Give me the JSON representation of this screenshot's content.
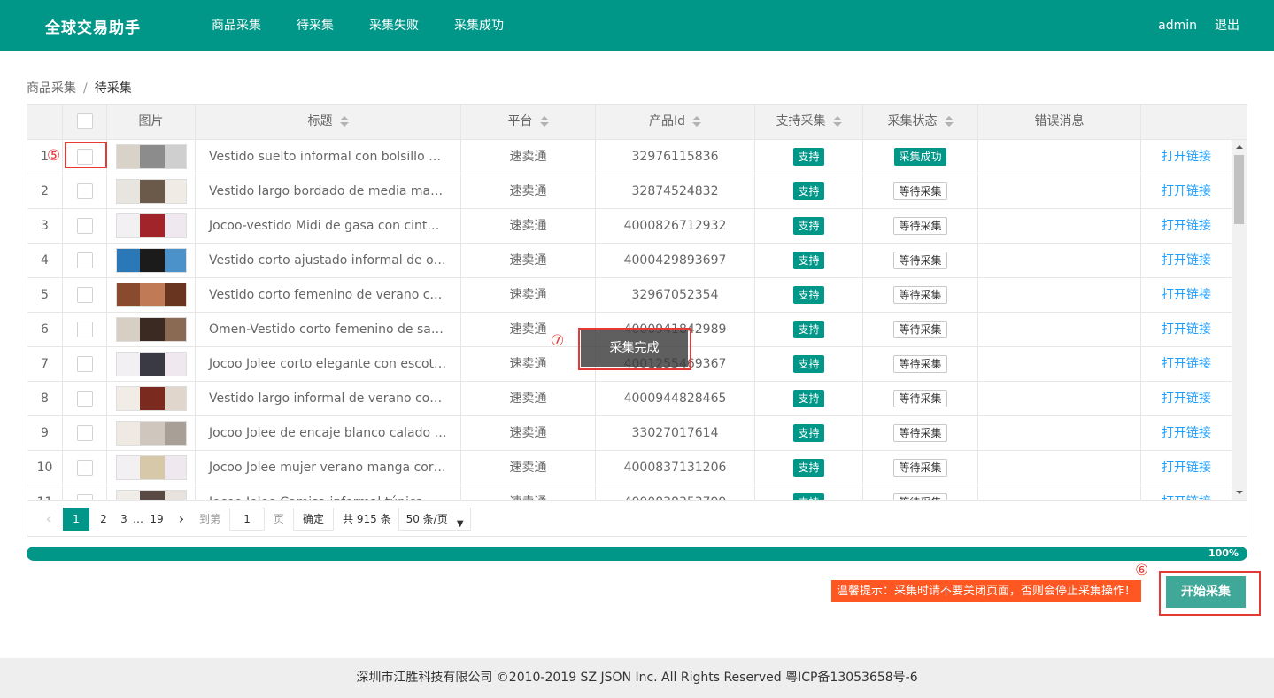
{
  "app": {
    "title": "全球交易助手"
  },
  "nav": [
    "商品采集",
    "待采集",
    "采集失败",
    "采集成功"
  ],
  "user": {
    "name": "admin",
    "logout": "退出"
  },
  "breadcrumb": {
    "parent": "商品采集",
    "separator": "/",
    "current": "待采集"
  },
  "table": {
    "headers": [
      "",
      "",
      "图片",
      "标题",
      "平台",
      "产品Id",
      "支持采集",
      "采集状态",
      "错误消息",
      ""
    ],
    "rows": [
      {
        "n": "1",
        "title": "Vestido suelto informal con bolsillo para mujer",
        "platform": "速卖通",
        "pid": "32976115836",
        "support": "支持",
        "status": "采集成功",
        "status_type": "success",
        "link": "打开链接"
      },
      {
        "n": "2",
        "title": "Vestido largo bordado de media manga mujer",
        "platform": "速卖通",
        "pid": "32874524832",
        "support": "支持",
        "status": "等待采集",
        "status_type": "wait",
        "link": "打开链接"
      },
      {
        "n": "3",
        "title": "Jocoo-vestido Midi de gasa con cintura elástica",
        "platform": "速卖通",
        "pid": "4000826712932",
        "support": "支持",
        "status": "等待采集",
        "status_type": "wait",
        "link": "打开链接"
      },
      {
        "n": "4",
        "title": "Vestido corto ajustado informal de oficina mujer",
        "platform": "速卖通",
        "pid": "4000429893697",
        "support": "支持",
        "status": "等待采集",
        "status_type": "wait",
        "link": "打开链接"
      },
      {
        "n": "5",
        "title": "Vestido corto femenino de verano con estampado",
        "platform": "速卖通",
        "pid": "32967052354",
        "support": "支持",
        "status": "等待采集",
        "status_type": "wait",
        "link": "打开链接"
      },
      {
        "n": "6",
        "title": "Omen-Vestido corto femenino de satén con tirantes",
        "platform": "速卖通",
        "pid": "4000941842989",
        "support": "支持",
        "status": "等待采集",
        "status_type": "wait",
        "link": "打开链接"
      },
      {
        "n": "7",
        "title": "Jocoo Jolee corto elegante con escote en V mujer",
        "platform": "速卖通",
        "pid": "4001255469367",
        "support": "支持",
        "status": "等待采集",
        "status_type": "wait",
        "link": "打开链接"
      },
      {
        "n": "8",
        "title": "Vestido largo informal de verano con estampado",
        "platform": "速卖通",
        "pid": "4000944828465",
        "support": "支持",
        "status": "等待采集",
        "status_type": "wait",
        "link": "打开链接"
      },
      {
        "n": "9",
        "title": "Jocoo Jolee de encaje blanco calado elegante",
        "platform": "速卖通",
        "pid": "33027017614",
        "support": "支持",
        "status": "等待采集",
        "status_type": "wait",
        "link": "打开链接"
      },
      {
        "n": "10",
        "title": "Jocoo Jolee mujer verano manga corta Boho",
        "platform": "速卖通",
        "pid": "4000837131206",
        "support": "支持",
        "status": "等待采集",
        "status_type": "wait",
        "link": "打开链接"
      },
      {
        "n": "11",
        "title": "Jocoo Jolee Camisa informal túnica holgada",
        "platform": "速卖通",
        "pid": "4000838353799",
        "support": "支持",
        "status": "等待采集",
        "status_type": "wait",
        "link": "打开链接"
      }
    ]
  },
  "pager": {
    "pages": [
      "1",
      "2",
      "3"
    ],
    "ellipsis": "…",
    "last": "19",
    "goto_label": "到第",
    "goto_value": "1",
    "page_unit": "页",
    "confirm": "确定",
    "total": "共 915 条",
    "per_page": "50 条/页"
  },
  "progress": {
    "value": 1.0,
    "label": "100%"
  },
  "tip": "温馨提示：采集时请不要关闭页面，否则会停止采集操作！",
  "start_button": "开始采集",
  "toast": "采集完成",
  "annotations": {
    "five": "⑤",
    "six": "⑥",
    "seven": "⑦"
  },
  "footer": "深圳市江胜科技有限公司 ©2010-2019 SZ JSON Inc. All Rights Reserved 粤ICP备13053658号-6",
  "colors": {
    "primary": "#009688",
    "warn": "#ff5722",
    "link": "#1e9fff",
    "annotation": "#e53935"
  }
}
